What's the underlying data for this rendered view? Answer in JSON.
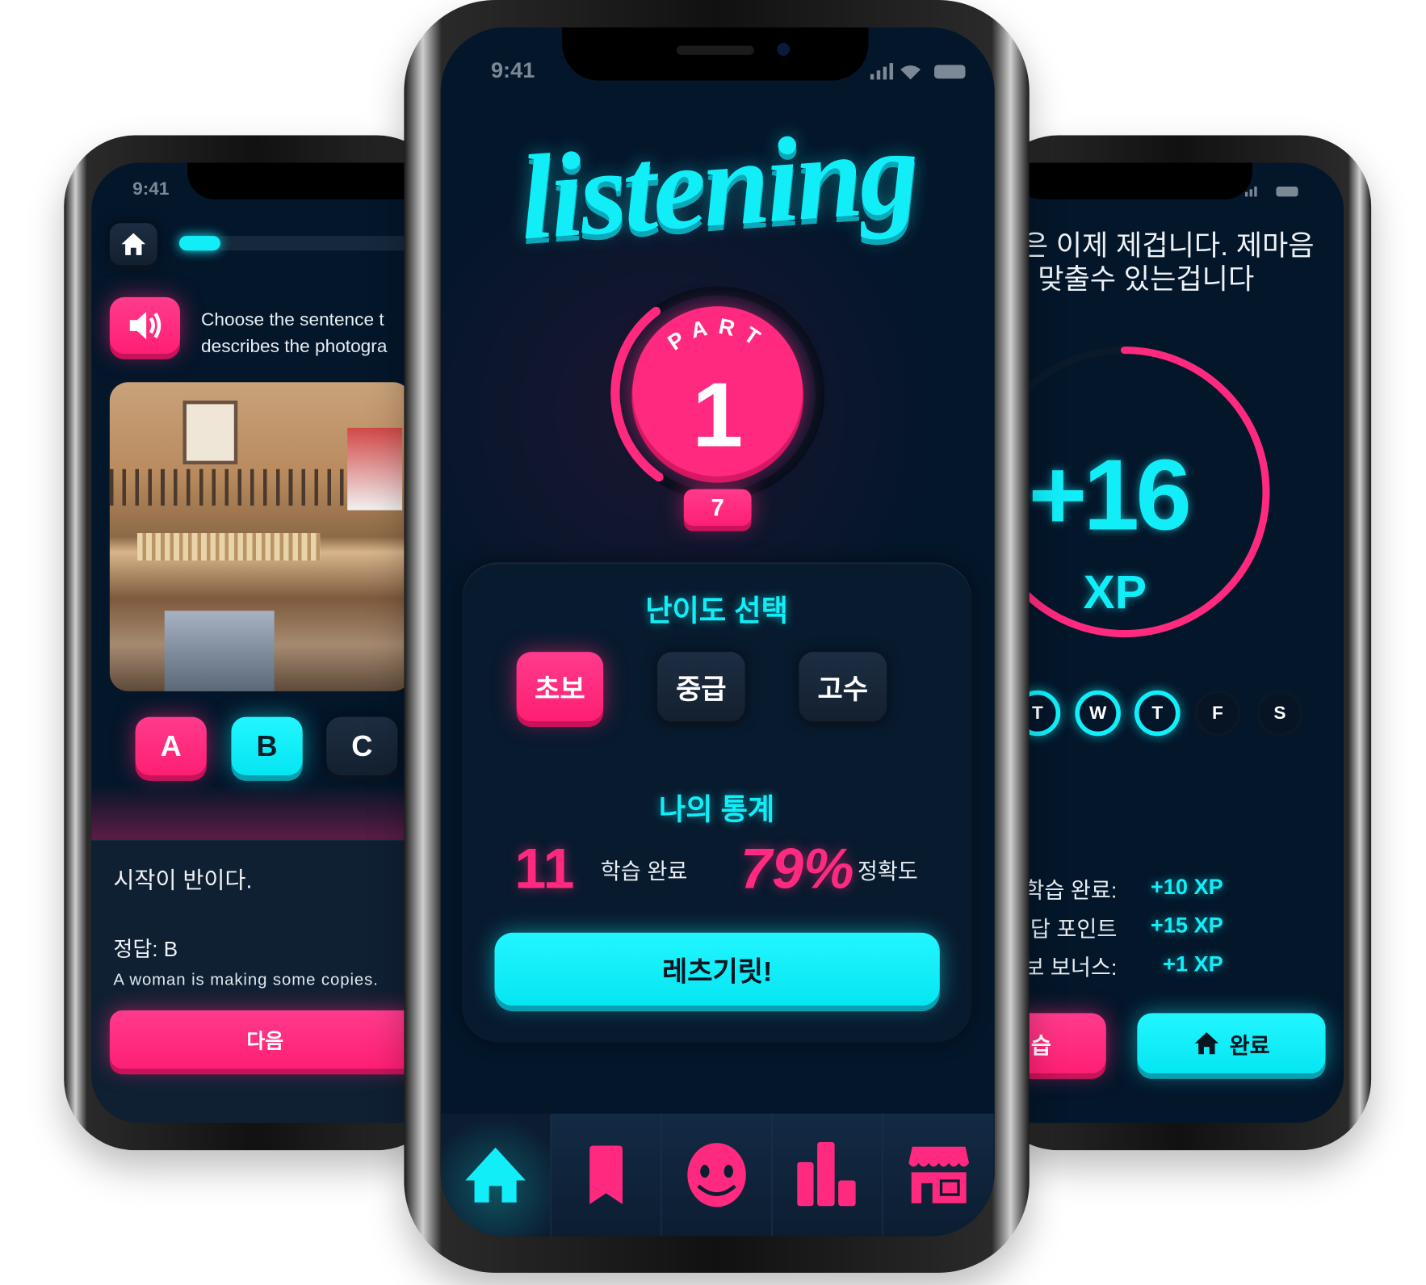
{
  "colors": {
    "accent_pink": "#ff2a7f",
    "accent_cyan": "#12eef8",
    "background": "#04162a"
  },
  "left_phone": {
    "status_time": "9:41",
    "home_icon": "home-icon",
    "progress": 0.15,
    "speaker_icon": "speaker-icon",
    "prompt_line1": "Choose the sentence t",
    "prompt_line2": "describes the photogra",
    "options": [
      "A",
      "B",
      "C"
    ],
    "selected_option": "B",
    "proverb": "시작이 반이다.",
    "answer_label": "정답: B",
    "answer_sentence": "A woman is making some copies.",
    "next_label": "다음"
  },
  "center_phone": {
    "status_time": "9:41",
    "title": "listening",
    "part_label": "PART",
    "part_number": "1",
    "badge": "7",
    "part_progress": 0.3,
    "difficulty_title": "난이도 선택",
    "difficulty_options": [
      "초보",
      "중급",
      "고수"
    ],
    "selected_difficulty": "초보",
    "stats_title": "나의 통계",
    "completed_value": "11",
    "completed_label": "학습 완료",
    "accuracy_value": "79%",
    "accuracy_label": "정확도",
    "start_label": "레츠기릿!",
    "nav": [
      {
        "icon": "home-icon",
        "active": true
      },
      {
        "icon": "bookmark-icon"
      },
      {
        "icon": "smiley-icon"
      },
      {
        "icon": "bar-chart-icon"
      },
      {
        "icon": "store-icon"
      }
    ]
  },
  "right_phone": {
    "text_line1": "은 이제 제겁니다. 제마음",
    "text_line2": ". 맞출수 있는겁니다",
    "xp_value": "+16",
    "xp_unit": "XP",
    "xp_progress": 0.8,
    "days": [
      {
        "label": "T",
        "done": true
      },
      {
        "label": "W",
        "done": true
      },
      {
        "label": "T",
        "done": true
      },
      {
        "label": "F",
        "done": false
      },
      {
        "label": "S",
        "done": false
      }
    ],
    "rewards": [
      {
        "label": "학습 완료:",
        "value": "+10 XP"
      },
      {
        "label": "정답 포인트",
        "value": "+15 XP"
      },
      {
        "label": "콤보 보너스:",
        "value": "+1 XP"
      }
    ],
    "retry_label": "습",
    "done_label": "완료"
  }
}
